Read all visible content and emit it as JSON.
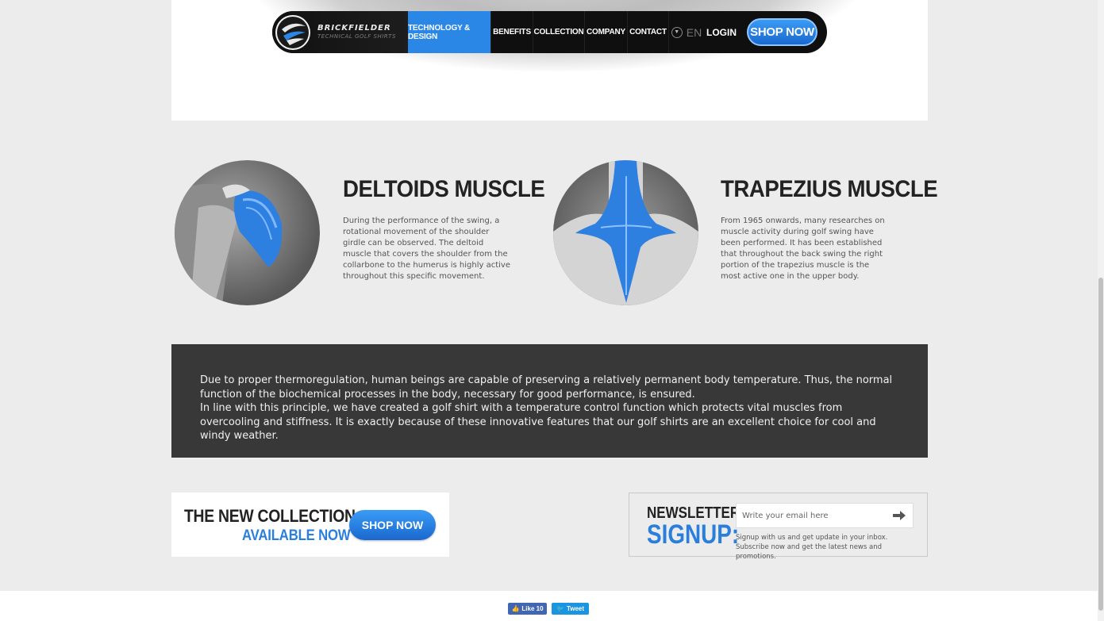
{
  "nav": {
    "logo_name": "BRICKFIELDER",
    "logo_sub": "TECHNICAL GOLF SHIRTS",
    "items": [
      {
        "label": "TECHNOLOGY & DESIGN",
        "active": true
      },
      {
        "label": "BENEFITS"
      },
      {
        "label": "COLLECTION"
      },
      {
        "label": "COMPANY"
      },
      {
        "label": "CONTACT"
      }
    ],
    "language": "EN",
    "login": "LOGIN",
    "shop_now": "SHOP NOW"
  },
  "muscles": [
    {
      "title": "DELTOIDS MUSCLE",
      "text": "During the performance of the swing, a rotational movement of the shoulder girdle can be observed. The deltoid muscle that covers the shoulder from the collarbone to the humerus is highly active throughout this specific movement."
    },
    {
      "title": "TRAPEZIUS MUSCLE",
      "text": "From 1965 onwards, many researches on muscle activity during golf swing have been performed. It has been established that throughout the back swing the right portion of the trapezius muscle is the most active one in the upper body."
    }
  ],
  "info": {
    "paragraph1": "Due to proper thermoregulation, human beings are capable of preserving a relatively permanent body temperature. Thus, the normal function of the biochemical processes in the body, necessary for good performance, is ensured.",
    "paragraph2": "In line with this principle, we have created a golf shirt with a temperature control function which protects vital muscles from overcooling and stiffness. It is exactly because of these innovative features that our golf shirts are an excellent choice for cool and windy weather."
  },
  "promo": {
    "line1": "THE NEW COLLECTION",
    "line2": "AVAILABLE NOW",
    "button": "SHOP NOW"
  },
  "newsletter": {
    "title_line1": "NEWSLETTER",
    "title_line2": "SIGNUP:",
    "placeholder": "Write your email here",
    "note": "Signup with us and get update in your inbox. Subscribe now and get the latest news and promotions."
  },
  "social": {
    "like_label": "Like 10",
    "tweet_label": "Tweet"
  },
  "colors": {
    "accent": "#2b87e6",
    "dark_block": "#383838"
  }
}
